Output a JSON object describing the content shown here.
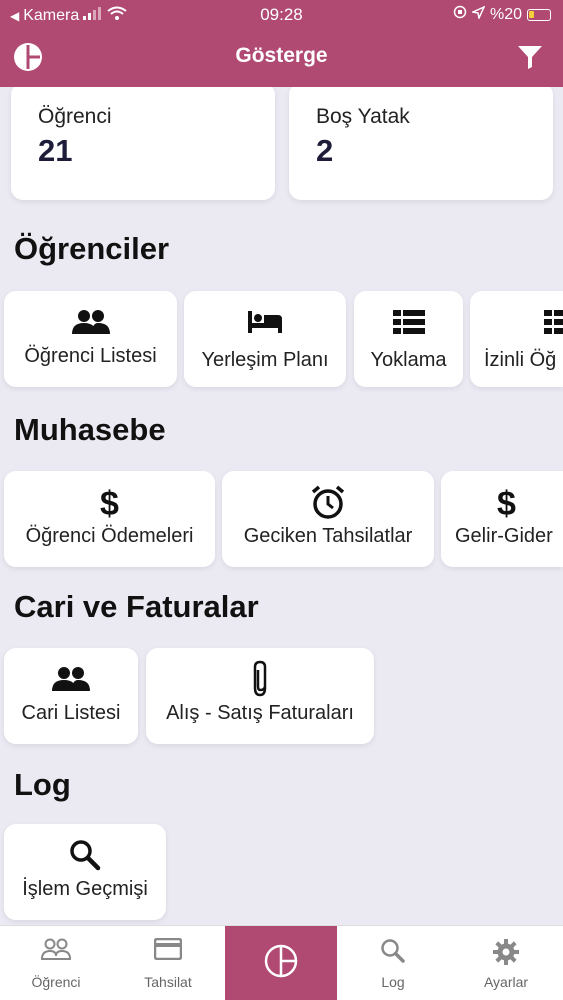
{
  "status_bar": {
    "back_app": "Kamera",
    "time": "09:28",
    "battery": "%20"
  },
  "navbar": {
    "title": "Gösterge",
    "left_icon": "logo-icon",
    "right_icon": "filter-icon"
  },
  "stats": [
    {
      "label": "Öğrenci",
      "value": "21"
    },
    {
      "label": "Boş Yatak",
      "value": "2"
    }
  ],
  "sections": {
    "ogrenciler": {
      "title": "Öğrenciler",
      "items": [
        {
          "label": "Öğrenci Listesi",
          "icon": "people-icon"
        },
        {
          "label": "Yerleşim Planı",
          "icon": "bed-icon"
        },
        {
          "label": "Yoklama",
          "icon": "list-icon"
        },
        {
          "label": "İzinli Öğ",
          "icon": "list-icon"
        }
      ]
    },
    "muhasebe": {
      "title": "Muhasebe",
      "items": [
        {
          "label": "Öğrenci Ödemeleri",
          "icon": "dollar-icon"
        },
        {
          "label": "Geciken Tahsilatlar",
          "icon": "alarm-icon"
        },
        {
          "label": "Gelir-Gider",
          "icon": "dollar-icon"
        }
      ]
    },
    "cari": {
      "title": "Cari ve Faturalar",
      "items": [
        {
          "label": "Cari Listesi",
          "icon": "people-icon"
        },
        {
          "label": "Alış - Satış Faturaları",
          "icon": "paperclip-icon"
        }
      ]
    },
    "log": {
      "title": "Log",
      "items": [
        {
          "label": "İşlem Geçmişi",
          "icon": "search-icon"
        }
      ]
    }
  },
  "tabbar": [
    {
      "label": "Öğrenci",
      "icon": "people-outline-icon"
    },
    {
      "label": "Tahsilat",
      "icon": "card-icon"
    },
    {
      "label": "",
      "icon": "logo-icon"
    },
    {
      "label": "Log",
      "icon": "search-icon"
    },
    {
      "label": "Ayarlar",
      "icon": "gear-icon"
    }
  ],
  "colors": {
    "brand": "#b04a73",
    "background": "#ebe9f2",
    "tab_label": "#666666"
  }
}
